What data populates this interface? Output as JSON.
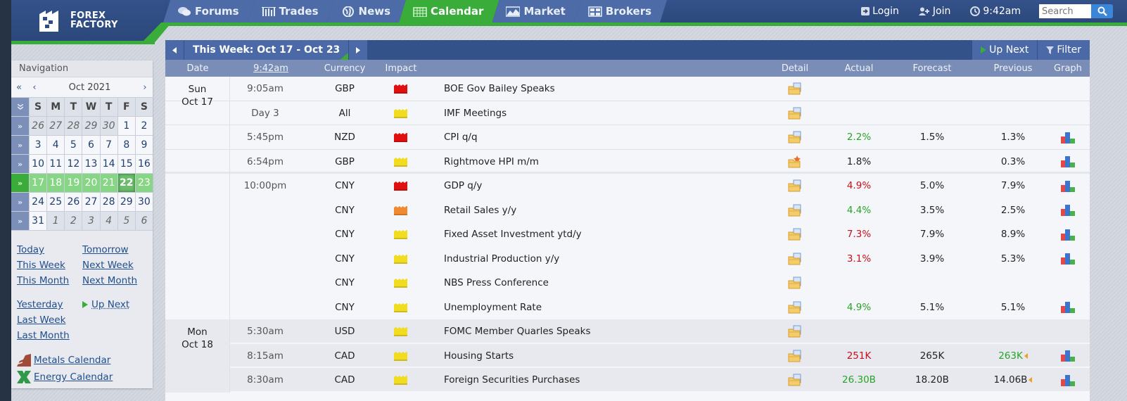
{
  "brand": {
    "line1": "FOREX",
    "line2": "FACTORY"
  },
  "nav_tabs": [
    {
      "label": "Forums",
      "icon": "forums-icon",
      "active": false
    },
    {
      "label": "Trades",
      "icon": "trades-icon",
      "active": false
    },
    {
      "label": "News",
      "icon": "news-icon",
      "active": false
    },
    {
      "label": "Calendar",
      "icon": "calendar-icon",
      "active": true
    },
    {
      "label": "Market",
      "icon": "market-icon",
      "active": false
    },
    {
      "label": "Brokers",
      "icon": "brokers-icon",
      "active": false
    }
  ],
  "header_right": {
    "login": "Login",
    "join": "Join",
    "time": "9:42am",
    "search_placeholder": "Search"
  },
  "sidebar": {
    "title": "Navigation",
    "month": "Oct 2021",
    "prev_year": "«",
    "prev_month": "‹",
    "next_month": "›",
    "week_toggle": "»",
    "weekdays": [
      "S",
      "M",
      "T",
      "W",
      "T",
      "F",
      "S"
    ],
    "weeks": [
      {
        "days": [
          "26",
          "27",
          "28",
          "29",
          "30",
          "1",
          "2"
        ],
        "other": [
          true,
          true,
          true,
          true,
          true,
          false,
          false
        ],
        "current": false
      },
      {
        "days": [
          "3",
          "4",
          "5",
          "6",
          "7",
          "8",
          "9"
        ],
        "other": [
          false,
          false,
          false,
          false,
          false,
          false,
          false
        ],
        "current": false
      },
      {
        "days": [
          "10",
          "11",
          "12",
          "13",
          "14",
          "15",
          "16"
        ],
        "other": [
          false,
          false,
          false,
          false,
          false,
          false,
          false
        ],
        "current": false
      },
      {
        "days": [
          "17",
          "18",
          "19",
          "20",
          "21",
          "22",
          "23"
        ],
        "other": [
          false,
          false,
          false,
          false,
          false,
          false,
          false
        ],
        "current": true,
        "today_index": 5
      },
      {
        "days": [
          "24",
          "25",
          "26",
          "27",
          "28",
          "29",
          "30"
        ],
        "other": [
          false,
          false,
          false,
          false,
          false,
          false,
          false
        ],
        "current": false
      },
      {
        "days": [
          "31",
          "1",
          "2",
          "3",
          "4",
          "5",
          "6"
        ],
        "other": [
          false,
          true,
          true,
          true,
          true,
          true,
          true
        ],
        "current": false
      }
    ],
    "links": {
      "today": "Today",
      "tomorrow": "Tomorrow",
      "this_week": "This Week",
      "next_week": "Next Week",
      "this_month": "This Month",
      "next_month": "Next Month",
      "yesterday": "Yesterday",
      "up_next": "Up Next",
      "last_week": "Last Week",
      "last_month": "Last Month",
      "metals": "Metals Calendar",
      "energy": "Energy Calendar"
    }
  },
  "calendar": {
    "week_title": "This Week: Oct 17 - Oct 23",
    "up_next": "Up Next",
    "filter": "Filter",
    "columns": {
      "date": "Date",
      "time": "9:42am",
      "currency": "Currency",
      "impact": "Impact",
      "detail": "Detail",
      "actual": "Actual",
      "forecast": "Forecast",
      "previous": "Previous",
      "graph": "Graph"
    },
    "impact_colors": {
      "high": "#e01010",
      "medium": "#f08a30",
      "low": "#f2dc20"
    },
    "day_groups": [
      {
        "day": "Sun",
        "date": "Oct 17",
        "events": [
          {
            "time": "9:05am",
            "currency": "GBP",
            "impact": "high",
            "event": "BOE Gov Bailey Speaks",
            "detail": "folder",
            "actual": "",
            "actual_color": "",
            "forecast": "",
            "previous": "",
            "previous_color": "",
            "revised": false,
            "graph": false
          },
          {
            "time": "Day 3",
            "currency": "All",
            "impact": "low",
            "event": "IMF Meetings",
            "detail": "folder",
            "actual": "",
            "actual_color": "",
            "forecast": "",
            "previous": "",
            "previous_color": "",
            "revised": false,
            "graph": false
          },
          {
            "time": "5:45pm",
            "currency": "NZD",
            "impact": "high",
            "event": "CPI q/q",
            "detail": "folder",
            "actual": "2.2%",
            "actual_color": "green",
            "forecast": "1.5%",
            "previous": "1.3%",
            "previous_color": "",
            "revised": false,
            "graph": true
          },
          {
            "time": "6:54pm",
            "currency": "GBP",
            "impact": "low",
            "event": "Rightmove HPI m/m",
            "detail": "folder-star",
            "actual": "1.8%",
            "actual_color": "",
            "forecast": "",
            "previous": "0.3%",
            "previous_color": "",
            "revised": false,
            "graph": true
          },
          {
            "time": "10:00pm",
            "currency": "CNY",
            "impact": "high",
            "event": "GDP q/y",
            "detail": "folder",
            "actual": "4.9%",
            "actual_color": "red",
            "forecast": "5.0%",
            "previous": "7.9%",
            "previous_color": "",
            "revised": false,
            "graph": true
          },
          {
            "time": "",
            "currency": "CNY",
            "impact": "medium",
            "event": "Retail Sales y/y",
            "detail": "folder",
            "actual": "4.4%",
            "actual_color": "green",
            "forecast": "3.5%",
            "previous": "2.5%",
            "previous_color": "",
            "revised": false,
            "graph": true
          },
          {
            "time": "",
            "currency": "CNY",
            "impact": "low",
            "event": "Fixed Asset Investment ytd/y",
            "detail": "folder",
            "actual": "7.3%",
            "actual_color": "red",
            "forecast": "7.9%",
            "previous": "8.9%",
            "previous_color": "",
            "revised": false,
            "graph": true
          },
          {
            "time": "",
            "currency": "CNY",
            "impact": "low",
            "event": "Industrial Production y/y",
            "detail": "folder",
            "actual": "3.1%",
            "actual_color": "red",
            "forecast": "3.9%",
            "previous": "5.3%",
            "previous_color": "",
            "revised": false,
            "graph": true
          },
          {
            "time": "",
            "currency": "CNY",
            "impact": "low",
            "event": "NBS Press Conference",
            "detail": "folder",
            "actual": "",
            "actual_color": "",
            "forecast": "",
            "previous": "",
            "previous_color": "",
            "revised": false,
            "graph": false
          },
          {
            "time": "",
            "currency": "CNY",
            "impact": "low",
            "event": "Unemployment Rate",
            "detail": "folder",
            "actual": "4.9%",
            "actual_color": "green",
            "forecast": "5.1%",
            "previous": "5.1%",
            "previous_color": "",
            "revised": false,
            "graph": true
          }
        ]
      },
      {
        "day": "Mon",
        "date": "Oct 18",
        "events": [
          {
            "time": "5:30am",
            "currency": "USD",
            "impact": "low",
            "event": "FOMC Member Quarles Speaks",
            "detail": "folder",
            "actual": "",
            "actual_color": "",
            "forecast": "",
            "previous": "",
            "previous_color": "",
            "revised": false,
            "graph": false
          },
          {
            "time": "8:15am",
            "currency": "CAD",
            "impact": "low",
            "event": "Housing Starts",
            "detail": "folder",
            "actual": "251K",
            "actual_color": "red",
            "forecast": "265K",
            "previous": "263K",
            "previous_color": "green",
            "revised": true,
            "graph": true
          },
          {
            "time": "8:30am",
            "currency": "CAD",
            "impact": "low",
            "event": "Foreign Securities Purchases",
            "detail": "folder",
            "actual": "26.30B",
            "actual_color": "green",
            "forecast": "18.20B",
            "previous": "14.06B",
            "previous_color": "",
            "revised": true,
            "graph": true
          }
        ]
      }
    ]
  }
}
